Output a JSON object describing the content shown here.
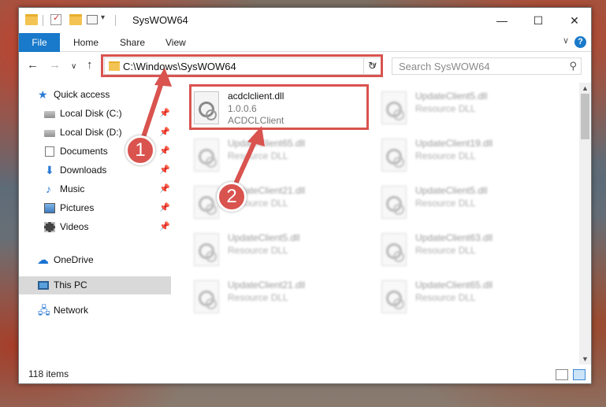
{
  "window": {
    "title": "SysWOW64",
    "minimize": "—",
    "maximize": "☐",
    "close": "✕"
  },
  "ribbon": {
    "file_tab": "File",
    "tabs": [
      "Home",
      "Share",
      "View"
    ],
    "help": "?",
    "expand": "∨"
  },
  "nav": {
    "back": "←",
    "forward": "→",
    "recent": "∨",
    "up": "↑",
    "address": "C:\\Windows\\SysWOW64",
    "address_dropdown": "∨",
    "refresh": "↻",
    "search_placeholder": "Search SysWOW64",
    "search_icon": "⚲"
  },
  "sidebar": {
    "items": [
      {
        "label": "Quick access",
        "icon": "star-icon"
      },
      {
        "label": "Local Disk (C:)",
        "icon": "disk-icon",
        "pinned": true
      },
      {
        "label": "Local Disk (D:)",
        "icon": "disk-icon",
        "pinned": true
      },
      {
        "label": "Documents",
        "icon": "documents-icon",
        "pinned": true
      },
      {
        "label": "Downloads",
        "icon": "downloads-icon",
        "pinned": true
      },
      {
        "label": "Music",
        "icon": "music-icon",
        "pinned": true
      },
      {
        "label": "Pictures",
        "icon": "pictures-icon",
        "pinned": true
      },
      {
        "label": "Videos",
        "icon": "videos-icon",
        "pinned": true
      },
      {
        "label": "OneDrive",
        "icon": "cloud-icon"
      },
      {
        "label": "This PC",
        "icon": "computer-icon",
        "selected": true
      },
      {
        "label": "Network",
        "icon": "network-icon"
      }
    ],
    "pin_glyph": "📌"
  },
  "files": [
    {
      "name": "acdclclient.dll",
      "line2": "1.0.0.6",
      "line3": "ACDCLClient",
      "highlighted": true
    },
    {
      "name": "UpdateClient5.dll",
      "line2": "Resource DLL"
    },
    {
      "name": "UpdateClient65.dll",
      "line2": "Resource DLL"
    },
    {
      "name": "UpdateClient19.dll",
      "line2": "Resource DLL"
    },
    {
      "name": "UpdateClient21.dll",
      "line2": "Resource DLL"
    },
    {
      "name": "UpdateClient5.dll",
      "line2": "Resource DLL"
    },
    {
      "name": "UpdateClient5.dll",
      "line2": "Resource DLL"
    },
    {
      "name": "UpdateClient63.dll",
      "line2": "Resource DLL"
    },
    {
      "name": "UpdateClient21.dll",
      "line2": "Resource DLL"
    },
    {
      "name": "UpdateClient65.dll",
      "line2": "Resource DLL"
    }
  ],
  "status": {
    "item_count": "118 items"
  },
  "scrollbar": {
    "up": "▲",
    "down": "▼"
  },
  "annotations": {
    "marker1": "1",
    "marker2": "2"
  },
  "colors": {
    "accent": "#1979ca",
    "annotation_red": "#d9534f",
    "selection": "#d9d9d9"
  }
}
